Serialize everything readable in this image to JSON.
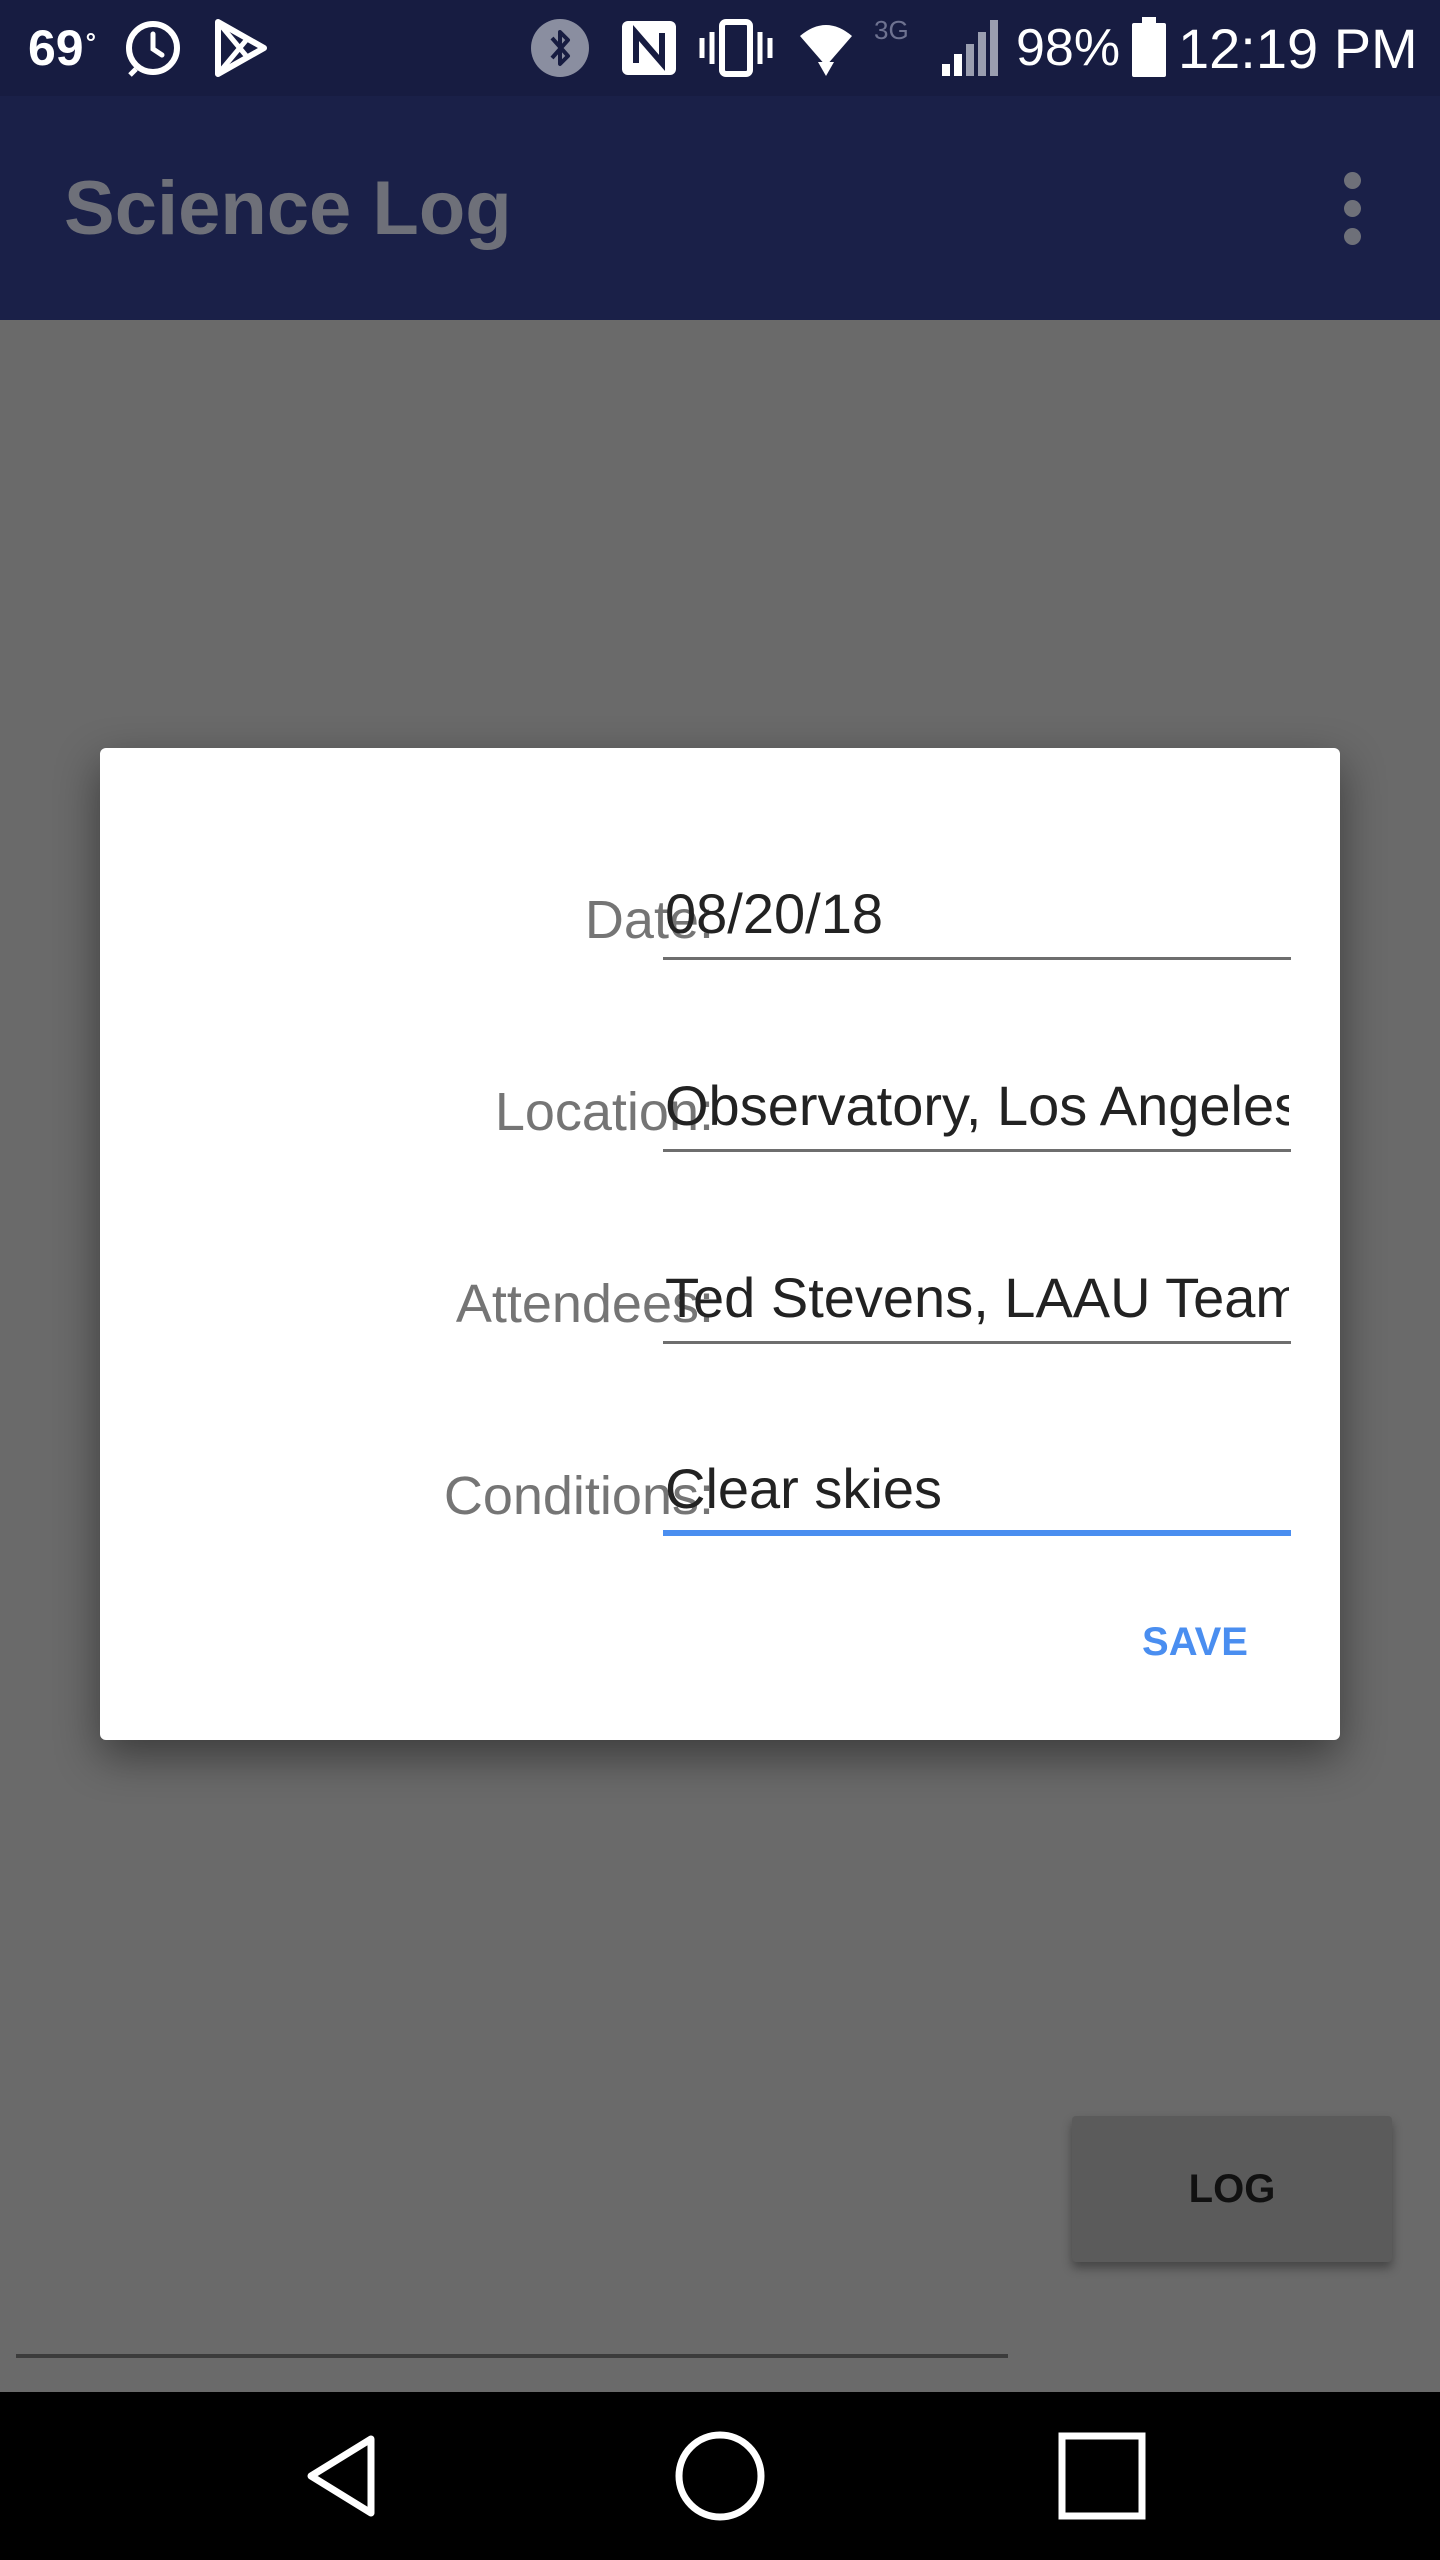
{
  "status_bar": {
    "temperature": "69",
    "degree": "°",
    "battery_percent": "98%",
    "time": "12:19 PM",
    "network": "3G",
    "icons": [
      "clock-icon",
      "play-store-icon",
      "bluetooth-icon",
      "nfc-icon",
      "vibrate-icon",
      "wifi-icon",
      "signal-icon",
      "battery-icon"
    ]
  },
  "app_bar": {
    "title": "Science Log",
    "menu_icon": "overflow-menu-icon"
  },
  "dialog": {
    "fields": [
      {
        "label": "Date:",
        "value": "08/20/18"
      },
      {
        "label": "Location:",
        "value": "Observatory, Los Angeles"
      },
      {
        "label": "Attendees:",
        "value": "Ted Stevens, LAAU Team"
      },
      {
        "label": "Conditions:",
        "value": "Clear skies"
      }
    ],
    "save_label": "SAVE"
  },
  "main": {
    "log_label": "LOG"
  },
  "nav_bar": {
    "icons": [
      "back-icon",
      "home-icon",
      "recents-icon"
    ]
  },
  "colors": {
    "status_bar": "#171c41",
    "app_bar": "#1a2048",
    "accent": "#4a8ef0",
    "scrim": "#6a6a6a",
    "dialog": "#ffffff"
  }
}
